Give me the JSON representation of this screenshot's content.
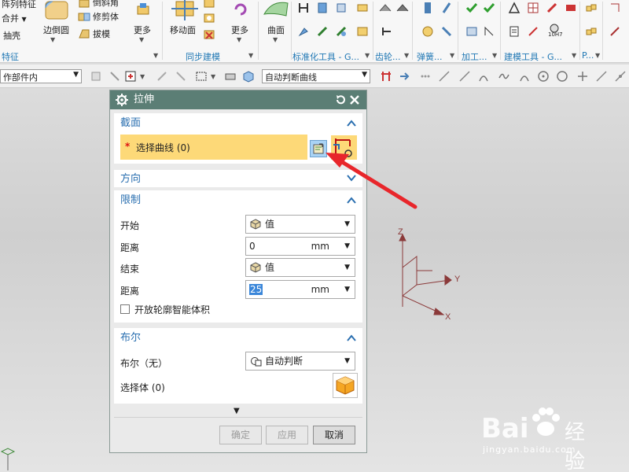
{
  "ribbon": {
    "items": {
      "array_feature": "阵列特征",
      "unite": "合并",
      "shell": "抽壳",
      "edge_blend": "边倒圆",
      "trim_body": "修剪体",
      "split_body": "拔模",
      "more1": "更多",
      "move_face": "移动面",
      "more2": "更多",
      "surface": "曲面",
      "hole_label": "10H7"
    },
    "groups": {
      "feature": "特征",
      "sync": "同步建模",
      "std_parts": "标准化工具 - G...",
      "gear": "齿轮...",
      "spring": "弹簧...",
      "machining": "加工...",
      "modeling_tools": "建模工具 - G...",
      "p": "P..."
    }
  },
  "toolbar": {
    "scope": "作部件内",
    "curve_rule": "自动判断曲线"
  },
  "dialog": {
    "title": "拉伸",
    "section": {
      "title": "截面",
      "required_mark": "*",
      "select_curve": "选择曲线 (0)"
    },
    "direction": {
      "title": "方向"
    },
    "limits": {
      "title": "限制",
      "start_label": "开始",
      "start_value": "值",
      "distance1_label": "距离",
      "distance1_value": "0",
      "distance1_unit": "mm",
      "end_label": "结束",
      "end_value": "值",
      "distance2_label": "距离",
      "distance2_value": "25",
      "distance2_unit": "mm",
      "open_profile": "开放轮廓智能体积"
    },
    "boolean": {
      "title": "布尔",
      "boolean_label": "布尔（无）",
      "boolean_value": "自动判断",
      "select_body": "选择体 (0)"
    },
    "buttons": {
      "ok": "确定",
      "apply": "应用",
      "cancel": "取消"
    }
  },
  "axes": {
    "z": "Z",
    "y": "Y",
    "x": "X"
  },
  "watermark": {
    "brand": "Bai",
    "brand2": "经验",
    "url": "jingyan.baidu.com"
  },
  "colors": {
    "accent_header": "#5b7e75",
    "section_text": "#2a6fb0",
    "highlight": "#fdd978",
    "arrow": "#e8262b"
  }
}
